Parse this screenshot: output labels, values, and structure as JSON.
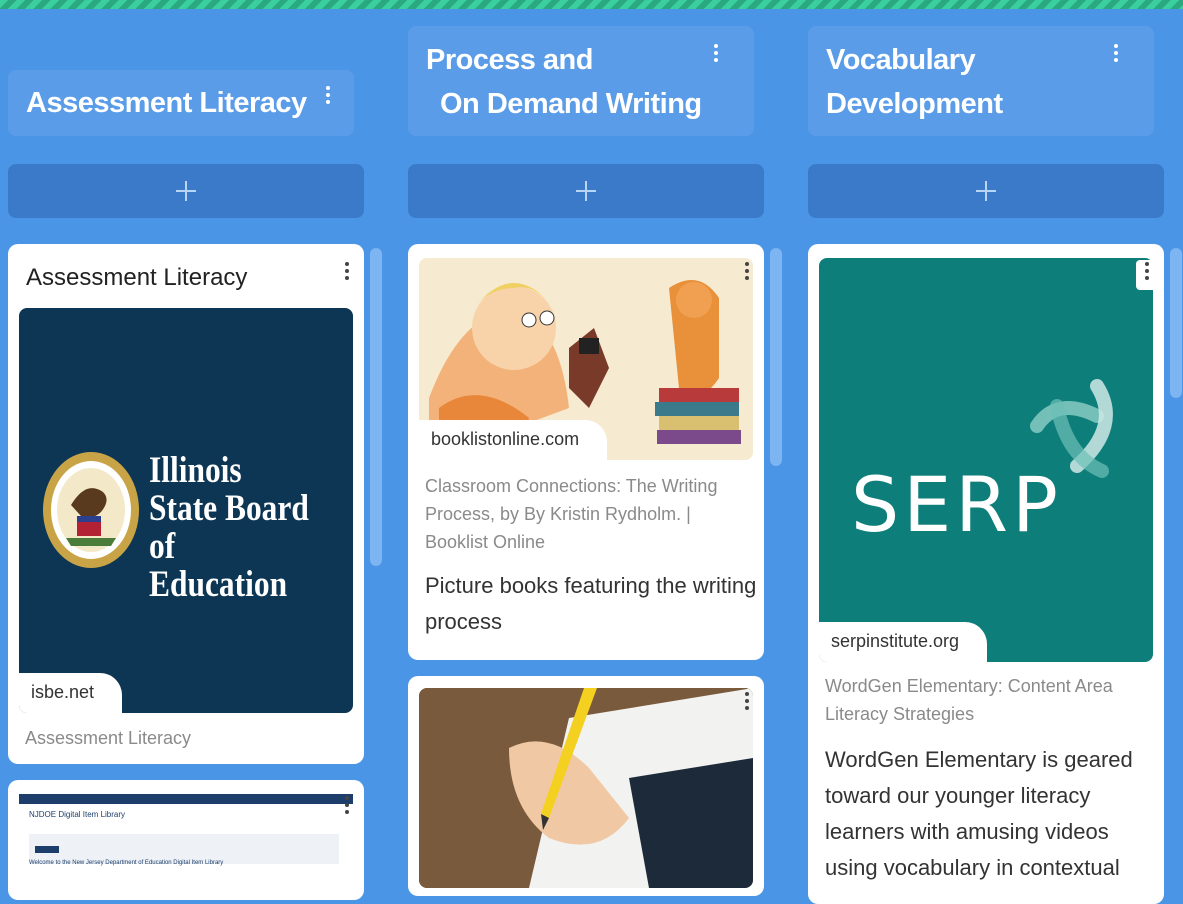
{
  "columns": [
    {
      "title": "Assessment Literacy",
      "cards": [
        {
          "title": "Assessment Literacy",
          "image_text": [
            "Illinois",
            "State Board of",
            "Education"
          ],
          "domain": "isbe.net",
          "source_title": "Assessment Literacy"
        },
        {
          "header": "NJDOE Digital Item Library",
          "welcome": "Welcome to the New Jersey Department of Education Digital Item Library"
        }
      ]
    },
    {
      "title_line1": "Process and",
      "title_line2": "On Demand Writing",
      "cards": [
        {
          "domain": "booklistonline.com",
          "source_title": [
            "Classroom Connections: The Writing",
            "Process, by By Kristin Rydholm. |",
            "Booklist Online"
          ],
          "description": [
            "Picture books featuring the writing",
            "process"
          ]
        }
      ]
    },
    {
      "title_line1": "Vocabulary",
      "title_line2": "Development",
      "cards": [
        {
          "image_text": "SERP",
          "domain": "serpinstitute.org",
          "source_title": [
            "WordGen Elementary: Content Area",
            "Literacy Strategies"
          ],
          "description": [
            "WordGen Elementary is geared",
            "toward our younger literacy",
            "learners with amusing videos",
            "using vocabulary in contextual"
          ]
        }
      ]
    }
  ],
  "colors": {
    "background": "#4a95e6",
    "column_header": "#5b9ce8",
    "add_button": "#3a7ac9",
    "serp_teal": "#0e7e7a",
    "isbe_navy": "#0d3654",
    "top_stripe": "#3bcf9e"
  },
  "icons": [
    "more-vertical-icon",
    "plus-icon"
  ]
}
